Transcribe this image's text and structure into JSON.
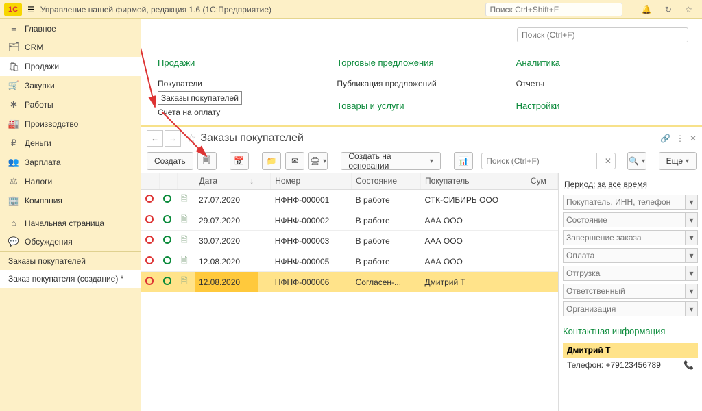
{
  "top": {
    "logo": "1C",
    "title": "Управление нашей фирмой, редакция 1.6  (1С:Предприятие)",
    "search_placeholder": "Поиск Ctrl+Shift+F"
  },
  "sidebar": {
    "items": [
      {
        "icon": "≡",
        "label": "Главное"
      },
      {
        "icon": "🗂",
        "label": "CRM"
      },
      {
        "icon": "🛍",
        "label": "Продажи"
      },
      {
        "icon": "🛒",
        "label": "Закупки"
      },
      {
        "icon": "✱",
        "label": "Работы"
      },
      {
        "icon": "🏭",
        "label": "Производство"
      },
      {
        "icon": "₽",
        "label": "Деньги"
      },
      {
        "icon": "👥",
        "label": "Зарплата"
      },
      {
        "icon": "⚖",
        "label": "Налоги"
      },
      {
        "icon": "🏢",
        "label": "Компания"
      }
    ],
    "sub": [
      {
        "icon": "⌂",
        "label": "Начальная страница"
      },
      {
        "icon": "💬",
        "label": "Обсуждения"
      }
    ],
    "open": [
      "Заказы покупателей",
      "Заказ покупателя (создание) *"
    ]
  },
  "content_search_placeholder": "Поиск (Ctrl+F)",
  "sections": {
    "col1": {
      "title": "Продажи",
      "links": [
        "Покупатели",
        "Заказы покупателей",
        "Счета на оплату"
      ]
    },
    "col2": {
      "title": "Торговые предложения",
      "links": [
        "Публикация предложений"
      ],
      "title2": "Товары и услуги"
    },
    "col3": {
      "title": "Аналитика",
      "links": [
        "Отчеты"
      ],
      "title2": "Настройки"
    }
  },
  "orders": {
    "title": "Заказы покупателей",
    "create": "Создать",
    "based_on": "Создать на основании",
    "search_placeholder": "Поиск (Ctrl+F)",
    "more": "Еще",
    "columns": [
      "",
      "",
      "",
      "Дата",
      "",
      "Номер",
      "Состояние",
      "Покупатель",
      "Сум"
    ],
    "rows": [
      {
        "date": "27.07.2020",
        "num": "НФНФ-000001",
        "state": "В работе",
        "buyer": "СТК-СИБИРЬ ООО"
      },
      {
        "date": "29.07.2020",
        "num": "НФНФ-000002",
        "state": "В работе",
        "buyer": "ААА ООО"
      },
      {
        "date": "30.07.2020",
        "num": "НФНФ-000003",
        "state": "В работе",
        "buyer": "ААА ООО"
      },
      {
        "date": "12.08.2020",
        "num": "НФНФ-000005",
        "state": "В работе",
        "buyer": "ААА ООО"
      },
      {
        "date": "12.08.2020",
        "num": "НФНФ-000006",
        "state": "Согласен-...",
        "buyer": "Дмитрий Т",
        "sel": true
      }
    ],
    "period": "Период: за все время",
    "filters": [
      "Покупатель, ИНН, телефон",
      "Состояние",
      "Завершение заказа",
      "Оплата",
      "Отгрузка",
      "Ответственный",
      "Организация"
    ],
    "contact_title": "Контактная информация",
    "contact_name": "Дмитрий Т",
    "contact_phone_label": "Телефон:",
    "contact_phone": "+79123456789"
  }
}
